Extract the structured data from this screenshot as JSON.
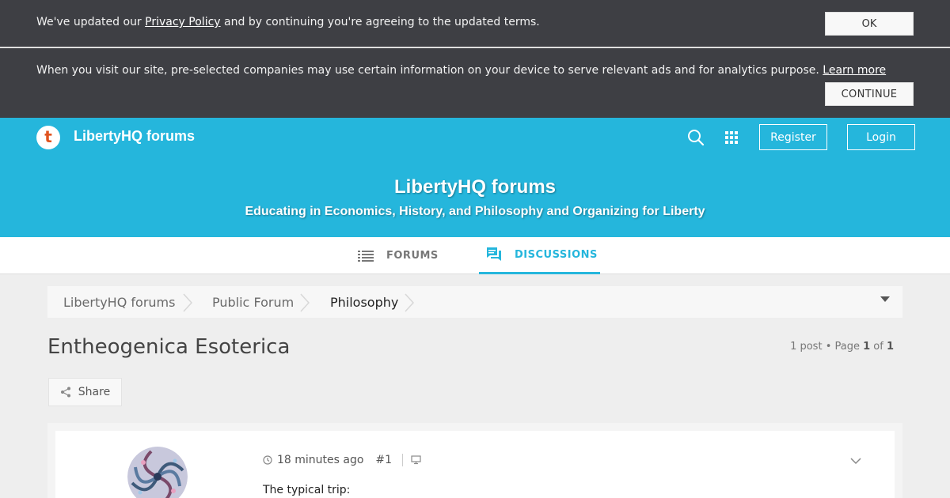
{
  "notices": {
    "privacy": {
      "text_before": "We've updated our ",
      "link": "Privacy Policy",
      "text_after": " and by continuing you're agreeing to the updated terms.",
      "button": "OK"
    },
    "ads": {
      "text": "When you visit our site, pre-selected companies may use certain information on your device to serve relevant ads and for analytics purpose. ",
      "link": "Learn more",
      "button": "CONTINUE"
    }
  },
  "header": {
    "logo_letter": "t",
    "brand": "LibertyHQ forums",
    "register": "Register",
    "login": "Login",
    "title": "LibertyHQ forums",
    "subtitle": "Educating in Economics, History, and Philosophy and Organizing for Liberty",
    "accent": "#25b6dc"
  },
  "tabs": {
    "forums": "FORUMS",
    "discussions": "DISCUSSIONS",
    "active": "discussions"
  },
  "breadcrumb": [
    "LibertyHQ forums",
    "Public Forum",
    "Philosophy"
  ],
  "topic": {
    "title": "Entheogenica Esoterica",
    "posts_label": "1 post",
    "bullet": " • Page ",
    "page": "1",
    "of": " of ",
    "pages": "1",
    "share": "Share"
  },
  "post": {
    "time": "18 minutes ago",
    "number": "#1",
    "body": "The typical trip:"
  },
  "icons": [
    "search-icon",
    "apps-grid-icon",
    "list-icon",
    "chat-icon",
    "share-icon",
    "clock-icon",
    "device-icon",
    "chevron-down-icon"
  ]
}
